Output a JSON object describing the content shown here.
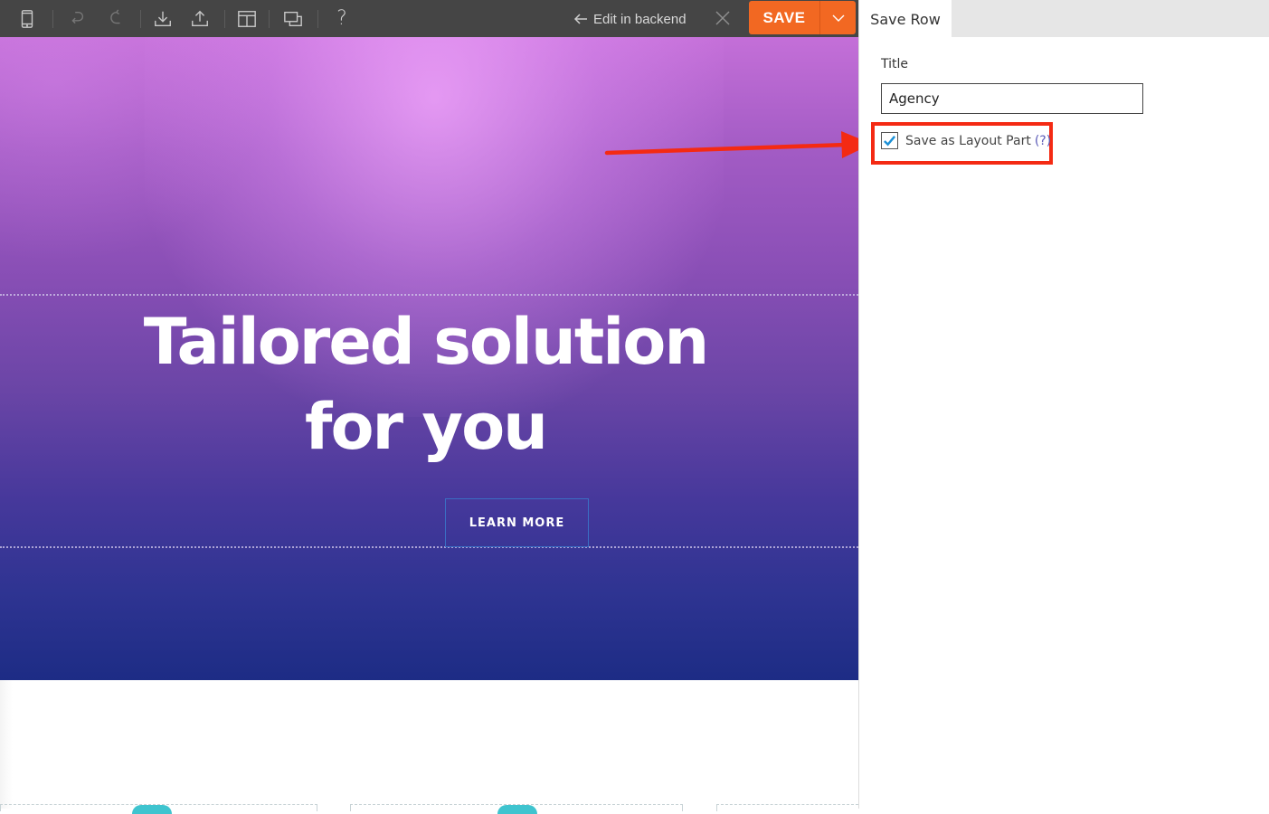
{
  "toolbar": {
    "icons": [
      {
        "name": "mobile-preview-icon",
        "enabled": true
      },
      {
        "name": "undo-icon",
        "enabled": false
      },
      {
        "name": "redo-icon",
        "enabled": false
      },
      {
        "name": "download-icon",
        "enabled": true
      },
      {
        "name": "upload-icon",
        "enabled": true
      },
      {
        "name": "layout-icon",
        "enabled": true
      },
      {
        "name": "responsive-preview-icon",
        "enabled": true
      },
      {
        "name": "help-icon",
        "enabled": true
      }
    ],
    "help_glyph": "?",
    "edit_backend_label": "Edit in backend",
    "save_label": "SAVE",
    "save_color": "#f26822"
  },
  "hero": {
    "title_line1": "Tailored solution",
    "title_line2": "for you",
    "button_label": "LEARN MORE",
    "gradient_top": "#c46fd8",
    "gradient_bottom": "#1d2c85"
  },
  "panel": {
    "tab_label": "Save Row",
    "title_label": "Title",
    "title_value": "Agency",
    "checkbox_label": "Save as Layout Part",
    "checkbox_checked": true,
    "help_link": "(?)",
    "highlight_color": "#f42a13"
  }
}
